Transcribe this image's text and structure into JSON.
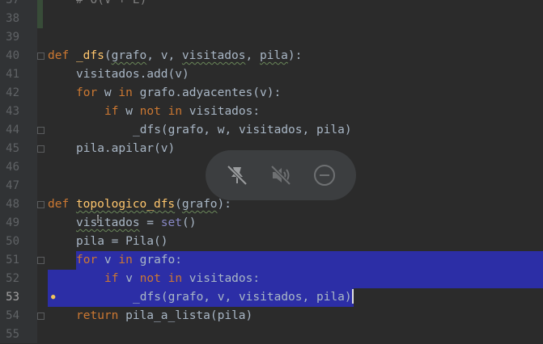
{
  "gutter": {
    "lines": [
      "37",
      "38",
      "39",
      "40",
      "41",
      "42",
      "43",
      "44",
      "45",
      "46",
      "47",
      "48",
      "49",
      "50",
      "51",
      "52",
      "53",
      "54",
      "55"
    ],
    "current_line": "53"
  },
  "code": {
    "comment_37": "# O(V + E)",
    "l40_def": "def",
    "l40_name": "_dfs",
    "l40_open": "(",
    "l40_p1": "grafo",
    "l40_c1": ", v, ",
    "l40_p2": "visitados",
    "l40_c2": ", ",
    "l40_p3": "pila",
    "l40_close": "):",
    "l41": "visitados.add(v)",
    "l42_for": "for",
    "l42_mid": " w ",
    "l42_in": "in",
    "l42_rest": " grafo.adyacentes(v):",
    "l43_if": "if",
    "l43_mid": " w ",
    "l43_not": "not in",
    "l43_rest": " visitados:",
    "l44": "_dfs(grafo, w, visitados, pila)",
    "l45": "pila.apilar(v)",
    "l48_def": "def",
    "l48_name": "topologico_dfs",
    "l48_open": "(",
    "l48_p1": "grafo",
    "l48_close": "):",
    "l49_var": "visitados",
    "l49_eq": " = ",
    "l49_set": "set",
    "l49_end": "()",
    "l50": "pila = Pila()",
    "l51_for": "for",
    "l51_mid": " v ",
    "l51_in": "in",
    "l51_rest": " grafo:",
    "l52_if": "if",
    "l52_mid": " v ",
    "l52_not": "not in",
    "l52_rest": " visitados:",
    "l53": "_dfs(grafo, v, visitados, pila)",
    "l54_return": "return",
    "l54_rest": " pila_a_lista(pila)"
  },
  "overlay": {
    "buttons": [
      "unpin-icon",
      "mute-icon",
      "minimize-icon"
    ]
  },
  "colors": {
    "background": "#2b2b2b",
    "gutter": "#313335",
    "selection": "#2c2ea6",
    "keyword": "#cc7832",
    "function": "#ffc66d",
    "builtin": "#8888c6"
  }
}
